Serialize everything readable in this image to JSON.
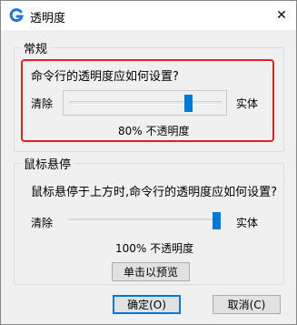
{
  "window": {
    "title": "透明度",
    "icon": "G-logo-icon",
    "close_glyph": "✕"
  },
  "general_group": {
    "title": "常规",
    "question": "命令行的透明度应如何设置?",
    "left_label": "清除",
    "right_label": "实体",
    "value_text": "80% 不透明度",
    "value_percent": 80
  },
  "hover_group": {
    "title": "鼠标悬停",
    "question": "鼠标悬停于上方时,命令行的透明度应如何设置?",
    "left_label": "清除",
    "right_label": "实体",
    "value_text": "100% 不透明度",
    "value_percent": 100,
    "preview_button": "单击以预览"
  },
  "buttons": {
    "ok": "确定(O)",
    "cancel": "取消(C)"
  },
  "colors": {
    "accent": "#0078d7",
    "highlight": "#e02020",
    "app_icon": "#1e78d2"
  }
}
